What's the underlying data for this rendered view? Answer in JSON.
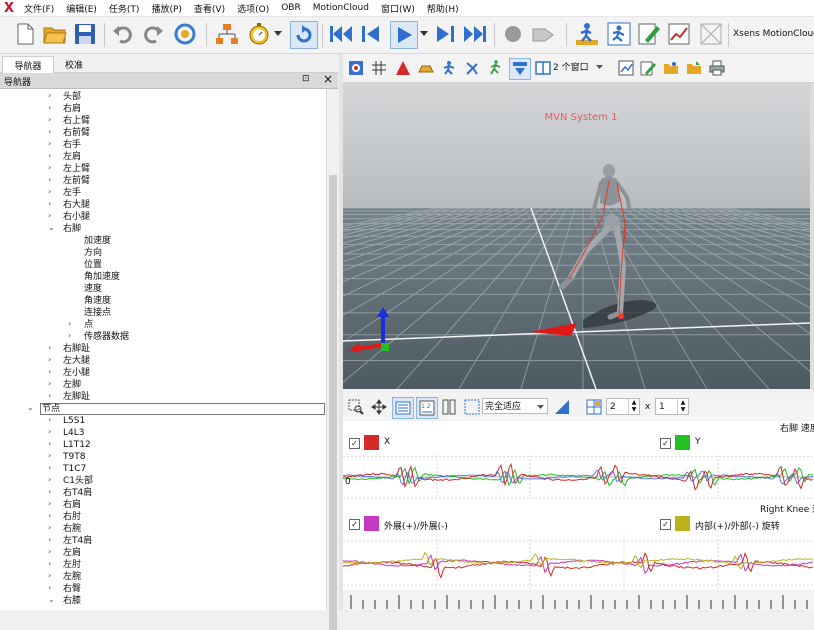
{
  "menu": {
    "logo": "X",
    "items": [
      "文件(F)",
      "编辑(E)",
      "任务(T)",
      "播放(P)",
      "查看(V)",
      "选项(O)",
      "OBR",
      "MotionCloud",
      "窗口(W)",
      "帮助(H)"
    ]
  },
  "toolbar": {
    "brand": "Xsens MotionCloud",
    "buttons": [
      "new-file",
      "open-folder",
      "save",
      "undo",
      "redo",
      "refresh-settings",
      "network",
      "stopwatch",
      "loop",
      "skip-to-start",
      "step-back",
      "play",
      "step-forward",
      "skip-to-end",
      "record",
      "tag",
      "walk-calibrate",
      "run-calibrate",
      "edit-notes",
      "chart",
      "grid-off"
    ]
  },
  "left_panel": {
    "tabs": [
      "导航器",
      "校准"
    ],
    "header_title": "导航器",
    "header_buttons": {
      "pin": "⊡",
      "close": "×"
    },
    "tree": [
      {
        "label": "头部",
        "indent": 1,
        "arrow": "›"
      },
      {
        "label": "右肩",
        "indent": 1,
        "arrow": "›"
      },
      {
        "label": "右上臂",
        "indent": 1,
        "arrow": "›"
      },
      {
        "label": "右前臂",
        "indent": 1,
        "arrow": "›"
      },
      {
        "label": "右手",
        "indent": 1,
        "arrow": "›"
      },
      {
        "label": "左肩",
        "indent": 1,
        "arrow": "›"
      },
      {
        "label": "左上臂",
        "indent": 1,
        "arrow": "›"
      },
      {
        "label": "左前臂",
        "indent": 1,
        "arrow": "›"
      },
      {
        "label": "左手",
        "indent": 1,
        "arrow": "›"
      },
      {
        "label": "右大腿",
        "indent": 1,
        "arrow": "›"
      },
      {
        "label": "右小腿",
        "indent": 1,
        "arrow": "›"
      },
      {
        "label": "右脚",
        "indent": 1,
        "arrow": "⌄"
      },
      {
        "label": "加速度",
        "indent": 2,
        "arrow": ""
      },
      {
        "label": "方向",
        "indent": 2,
        "arrow": ""
      },
      {
        "label": "位置",
        "indent": 2,
        "arrow": ""
      },
      {
        "label": "角加速度",
        "indent": 2,
        "arrow": ""
      },
      {
        "label": "速度",
        "indent": 2,
        "arrow": ""
      },
      {
        "label": "角速度",
        "indent": 2,
        "arrow": ""
      },
      {
        "label": "连接点",
        "indent": 2,
        "arrow": ""
      },
      {
        "label": "点",
        "indent": 2,
        "arrow": "›"
      },
      {
        "label": "传感器数据",
        "indent": 2,
        "arrow": "›"
      },
      {
        "label": "右脚趾",
        "indent": 1,
        "arrow": "›"
      },
      {
        "label": "左大腿",
        "indent": 1,
        "arrow": "›"
      },
      {
        "label": "左小腿",
        "indent": 1,
        "arrow": "›"
      },
      {
        "label": "左脚",
        "indent": 1,
        "arrow": "›"
      },
      {
        "label": "左脚趾",
        "indent": 1,
        "arrow": "›"
      },
      {
        "label": "节点",
        "indent": 0,
        "arrow": "⌄",
        "selected": true
      },
      {
        "label": "L5S1",
        "indent": 1,
        "arrow": "›"
      },
      {
        "label": "L4L3",
        "indent": 1,
        "arrow": "›"
      },
      {
        "label": "L1T12",
        "indent": 1,
        "arrow": "›"
      },
      {
        "label": "T9T8",
        "indent": 1,
        "arrow": "›"
      },
      {
        "label": "T1C7",
        "indent": 1,
        "arrow": "›"
      },
      {
        "label": "C1头部",
        "indent": 1,
        "arrow": "›"
      },
      {
        "label": "右T4肩",
        "indent": 1,
        "arrow": "›"
      },
      {
        "label": "右肩",
        "indent": 1,
        "arrow": "›"
      },
      {
        "label": "右肘",
        "indent": 1,
        "arrow": "›"
      },
      {
        "label": "右腕",
        "indent": 1,
        "arrow": "›"
      },
      {
        "label": "左T4肩",
        "indent": 1,
        "arrow": "›"
      },
      {
        "label": "左肩",
        "indent": 1,
        "arrow": "›"
      },
      {
        "label": "左肘",
        "indent": 1,
        "arrow": "›"
      },
      {
        "label": "左腕",
        "indent": 1,
        "arrow": "›"
      },
      {
        "label": "右臀",
        "indent": 1,
        "arrow": "›"
      },
      {
        "label": "右膝",
        "indent": 1,
        "arrow": "⌄"
      }
    ]
  },
  "viewer": {
    "label": "MVN  System  1",
    "window_select": "2 个窗口"
  },
  "graph_toolbar": {
    "fit_select": "完全适应",
    "rows_value": "2",
    "times_sign": "x",
    "cols_value": "1"
  },
  "graphs": [
    {
      "title": "右脚 速度",
      "zero_label": "0",
      "legend": [
        {
          "label": "X",
          "color": "#d42a2a"
        },
        {
          "label": "Y",
          "color": "#22c022"
        }
      ]
    },
    {
      "title": "Right Knee 运动",
      "legend": [
        {
          "label": "外展(+)/外展(-)",
          "color": "#c23ac2"
        },
        {
          "label": "内部(+)/外部(-) 旋转",
          "color": "#b9b41a"
        }
      ]
    }
  ],
  "colors": {
    "accent": "#2f6fd0",
    "floor": "#5e6a72",
    "sky": "#c9cbcd",
    "selection": "#cde5ff"
  }
}
